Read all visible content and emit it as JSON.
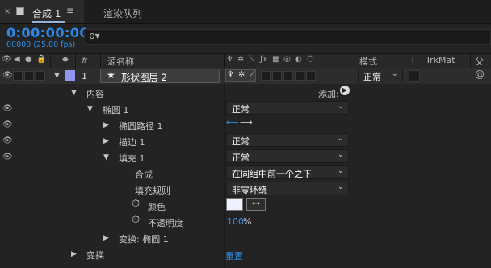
{
  "tabs": {
    "active_close": "×",
    "active_label": "合成 1",
    "active_menu": "≡",
    "second_label": "渲染队列"
  },
  "time": {
    "timecode": "0:00:00:00",
    "frames": "00000 (25.00 fps)"
  },
  "search": {
    "icon": "ρ▾"
  },
  "header": {
    "col_number": "#",
    "col_source": "源名称",
    "col_mode": "模式",
    "col_t": "T",
    "col_trkmat": "TrkMat",
    "col_parent": "父级"
  },
  "layer": {
    "number": "1",
    "name": "形状图层 2",
    "mode": "正常",
    "color": "#8f97f2"
  },
  "props": {
    "contents": "内容",
    "add_label": "添加:",
    "ellipse": "椭圆 1",
    "ellipse_mode": "正常",
    "ellipse_path": "椭圆路径 1",
    "stroke": "描边 1",
    "stroke_mode": "正常",
    "fill": "填充 1",
    "fill_mode": "正常",
    "composite": "合成",
    "composite_value": "在同组中前一个之下",
    "fill_rule": "填充规则",
    "fill_rule_value": "非零环绕",
    "color": "颜色",
    "opacity": "不透明度",
    "opacity_value": "100",
    "opacity_unit": "%",
    "ellipse_transform": "变换: 椭圆 1",
    "transform": "变换",
    "reset": "重置"
  },
  "colors": {
    "timecode": "#2d8ceb",
    "label": "#8f97f2",
    "fill_swatch": "#eef0ff"
  }
}
